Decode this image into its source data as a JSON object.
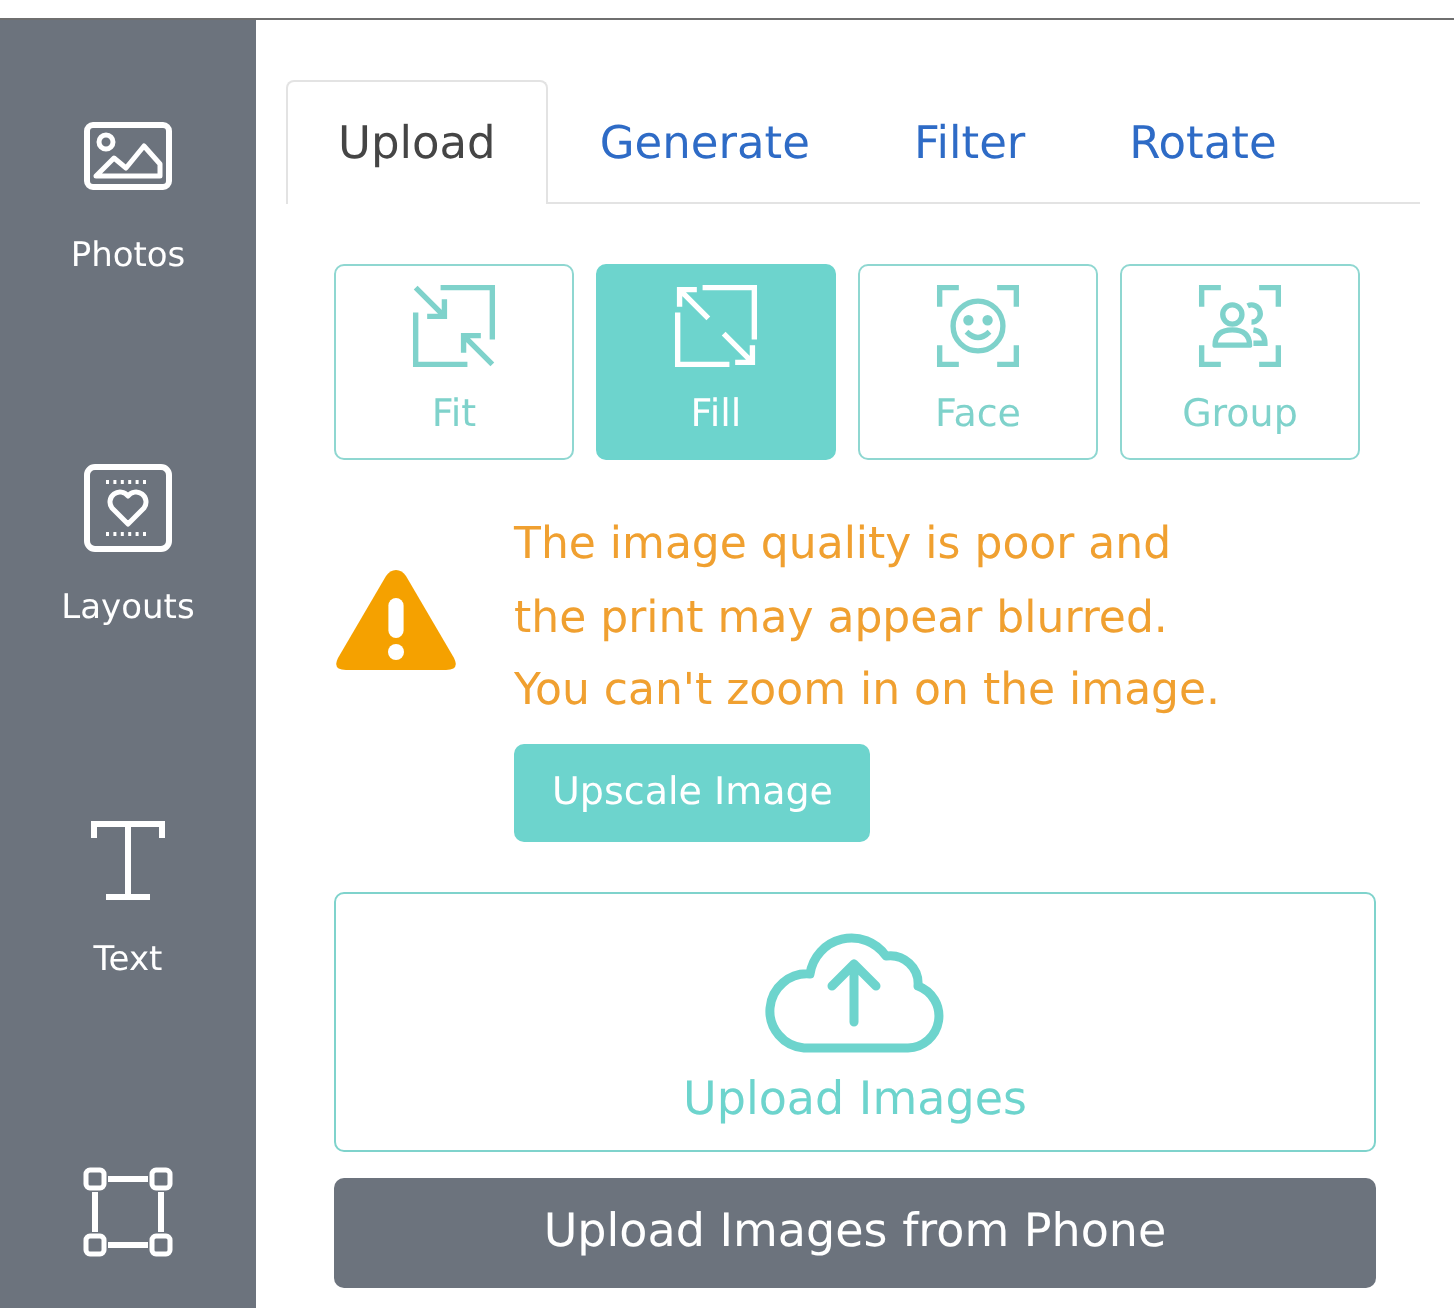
{
  "sidebar": {
    "items": [
      {
        "kind": "photo",
        "label": "Photos"
      },
      {
        "kind": "layout",
        "label": "Layouts"
      },
      {
        "kind": "text",
        "label": "Text"
      },
      {
        "kind": "shape"
      }
    ]
  },
  "tabs": [
    {
      "label": "Upload",
      "selected": true
    },
    {
      "label": "Generate",
      "selected": false
    },
    {
      "label": "Filter",
      "selected": false
    },
    {
      "label": "Rotate",
      "selected": false
    }
  ],
  "crop_modes": [
    {
      "kind": "fit",
      "label": "Fit",
      "selected": false
    },
    {
      "kind": "fill",
      "label": "Fill",
      "selected": true
    },
    {
      "kind": "face",
      "label": "Face",
      "selected": false
    },
    {
      "kind": "group",
      "label": "Group",
      "selected": false
    }
  ],
  "warning": {
    "message": "The image quality is poor and\nthe print may appear blurred.\nYou can't zoom in on the image.",
    "button": "Upscale Image"
  },
  "upload": {
    "label": "Upload Images"
  },
  "phone_button": "Upload Images from Phone"
}
